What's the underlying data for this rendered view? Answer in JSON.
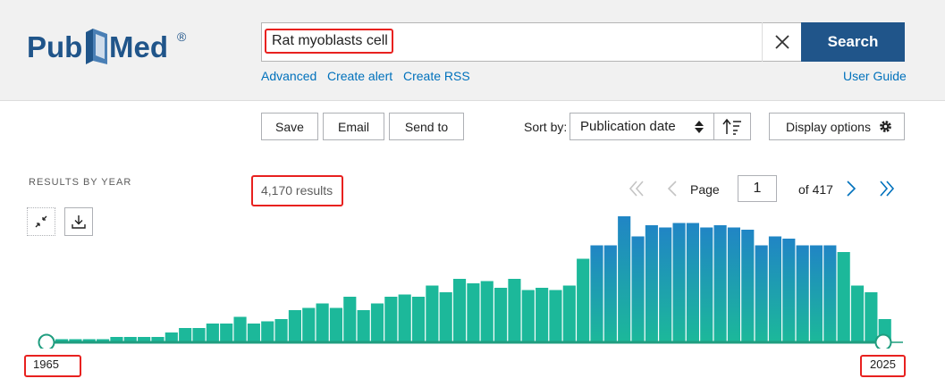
{
  "logo": {
    "text_left": "Pub",
    "text_right": "Med",
    "mark": "®"
  },
  "search": {
    "value": "Rat myoblasts cell",
    "placeholder": "",
    "button_label": "Search"
  },
  "links": {
    "advanced": "Advanced",
    "create_alert": "Create alert",
    "create_rss": "Create RSS",
    "user_guide": "User Guide"
  },
  "toolbar": {
    "save": "Save",
    "email": "Email",
    "send_to": "Send to",
    "sort_label": "Sort by:",
    "sort_value": "Publication date",
    "display_options": "Display options"
  },
  "results": {
    "title": "RESULTS BY YEAR",
    "count": "4,170 results"
  },
  "pager": {
    "page_label": "Page",
    "page_value": "1",
    "of_label": "of 417"
  },
  "chart_data": {
    "type": "bar",
    "start_year": "1965",
    "end_year": "2025",
    "values": [
      1,
      1,
      1,
      1,
      2,
      2,
      2,
      2,
      4,
      6,
      6,
      8,
      8,
      11,
      8,
      9,
      10,
      14,
      15,
      17,
      15,
      20,
      14,
      17,
      20,
      21,
      20,
      25,
      22,
      28,
      26,
      27,
      24,
      28,
      23,
      24,
      23,
      25,
      37,
      43,
      43,
      56,
      47,
      52,
      51,
      53,
      53,
      51,
      52,
      51,
      50,
      43,
      47,
      46,
      43,
      43,
      43,
      40,
      25,
      22,
      10
    ],
    "colors": {
      "low": "#1cb89a",
      "high": "#2085c5",
      "slider": "#1f9d7f"
    }
  }
}
